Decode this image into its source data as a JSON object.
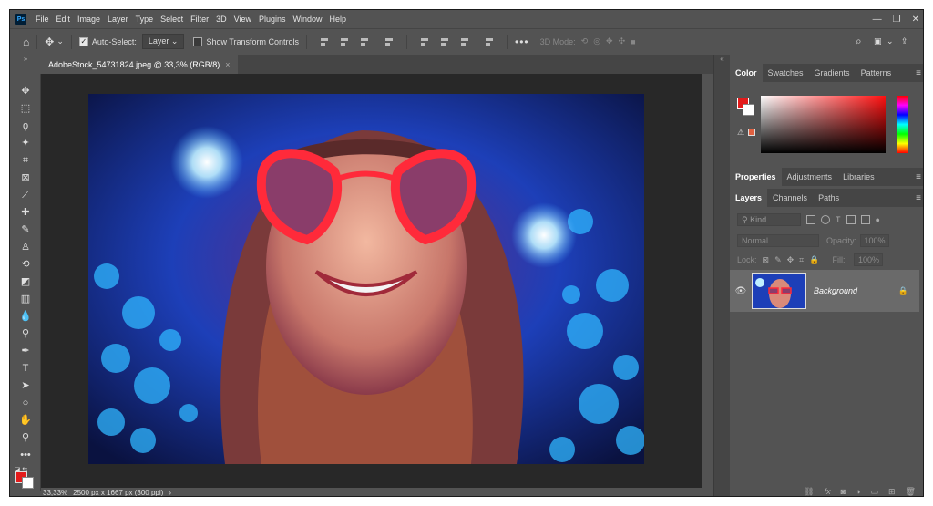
{
  "app": {
    "logo_text": "Ps"
  },
  "menubar": {
    "items": [
      "File",
      "Edit",
      "Image",
      "Layer",
      "Type",
      "Select",
      "Filter",
      "3D",
      "View",
      "Plugins",
      "Window",
      "Help"
    ]
  },
  "window_controls": [
    "minimize-icon",
    "restore-icon",
    "close-icon"
  ],
  "options_bar": {
    "auto_select_label": "Auto-Select:",
    "auto_select_checked": true,
    "auto_select_target": "Layer",
    "show_transform_label": "Show Transform Controls",
    "show_transform_checked": false,
    "mode_3d_label": "3D Mode:"
  },
  "document_tab": {
    "title": "AdobeStock_54731824.jpeg @ 33,3% (RGB/8)",
    "close": "×"
  },
  "status_bar": {
    "zoom": "33,33%",
    "doc_info": "2500 px x 1667 px (300 ppi)",
    "arrow": "›"
  },
  "colors": {
    "foreground": "#e31b1b",
    "background": "#ffffff",
    "ui_panel": "#535353",
    "canvas_bg": "#282828"
  },
  "color_panel": {
    "tabs": [
      "Color",
      "Swatches",
      "Gradients",
      "Patterns"
    ],
    "active_tab": "Color"
  },
  "properties_panel": {
    "tabs": [
      "Properties",
      "Adjustments",
      "Libraries"
    ],
    "active_tab": "Properties"
  },
  "layers_panel": {
    "tabs": [
      "Layers",
      "Channels",
      "Paths"
    ],
    "active_tab": "Layers",
    "kind_placeholder": "Kind",
    "blend_mode": "Normal",
    "opacity_label": "Opacity:",
    "opacity_value": "100%",
    "lock_label": "Lock:",
    "fill_label": "Fill:",
    "fill_value": "100%",
    "layers": [
      {
        "name": "Background",
        "visible": true,
        "locked": true
      }
    ]
  }
}
